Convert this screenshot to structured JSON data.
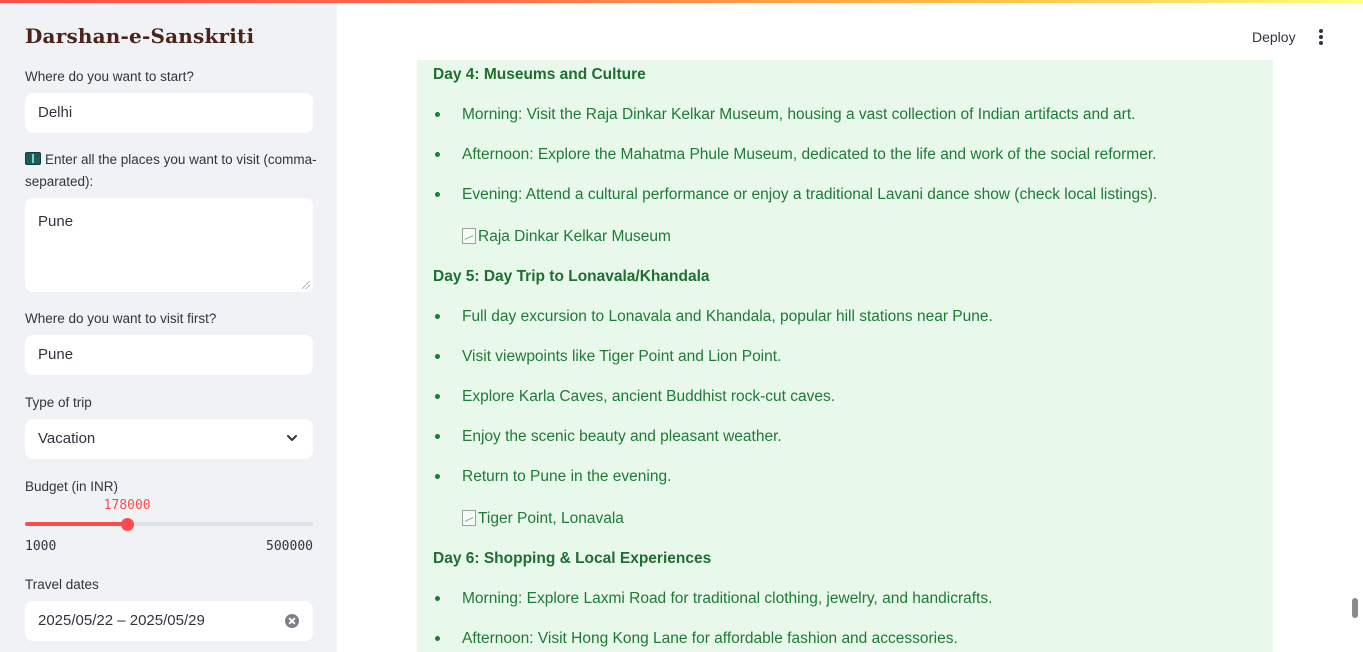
{
  "sidebar": {
    "app_title": "Darshan-e-Sanskriti",
    "start": {
      "label": "Where do you want to start?",
      "value": "Delhi"
    },
    "places": {
      "label_line1": "Enter all the places you want to visit (comma-",
      "label_line2": "separated):",
      "icon": "open-book-icon",
      "value": "Pune"
    },
    "first": {
      "label": "Where do you want to visit first?",
      "value": "Pune"
    },
    "trip_type": {
      "label": "Type of trip",
      "value": "Vacation"
    },
    "budget": {
      "label": "Budget (in INR)",
      "value": 178000,
      "value_label": "178000",
      "min": 1000,
      "max": 500000,
      "min_label": "1000",
      "max_label": "500000",
      "fill_fraction": 0.355
    },
    "dates": {
      "label": "Travel dates",
      "value": "2025/05/22 – 2025/05/29"
    }
  },
  "header": {
    "deploy_label": "Deploy",
    "menu_icon": "vertical-ellipsis-icon"
  },
  "itinerary": {
    "day4": {
      "title": "Day 4: Museums and Culture",
      "items": [
        "Morning: Visit the Raja Dinkar Kelkar Museum, housing a vast collection of Indian artifacts and art.",
        "Afternoon: Explore the Mahatma Phule Museum, dedicated to the life and work of the social reformer.",
        "Evening: Attend a cultural performance or enjoy a traditional Lavani dance show (check local listings)."
      ],
      "image_alt": "Raja Dinkar Kelkar Museum"
    },
    "day5": {
      "title": "Day 5: Day Trip to Lonavala/Khandala",
      "items": [
        "Full day excursion to Lonavala and Khandala, popular hill stations near Pune.",
        "Visit viewpoints like Tiger Point and Lion Point.",
        "Explore Karla Caves, ancient Buddhist rock-cut caves.",
        "Enjoy the scenic beauty and pleasant weather.",
        "Return to Pune in the evening."
      ],
      "image_alt": "Tiger Point, Lonavala"
    },
    "day6": {
      "title": "Day 6: Shopping & Local Experiences",
      "items": [
        "Morning: Explore Laxmi Road for traditional clothing, jewelry, and handicrafts.",
        "Afternoon: Visit Hong Kong Lane for affordable fashion and accessories."
      ]
    }
  },
  "colors": {
    "accent": "#ff4b4b",
    "sidebar_bg": "#f0f2f6",
    "content_bg": "#e8f9ec",
    "content_text": "#1e7a34"
  }
}
